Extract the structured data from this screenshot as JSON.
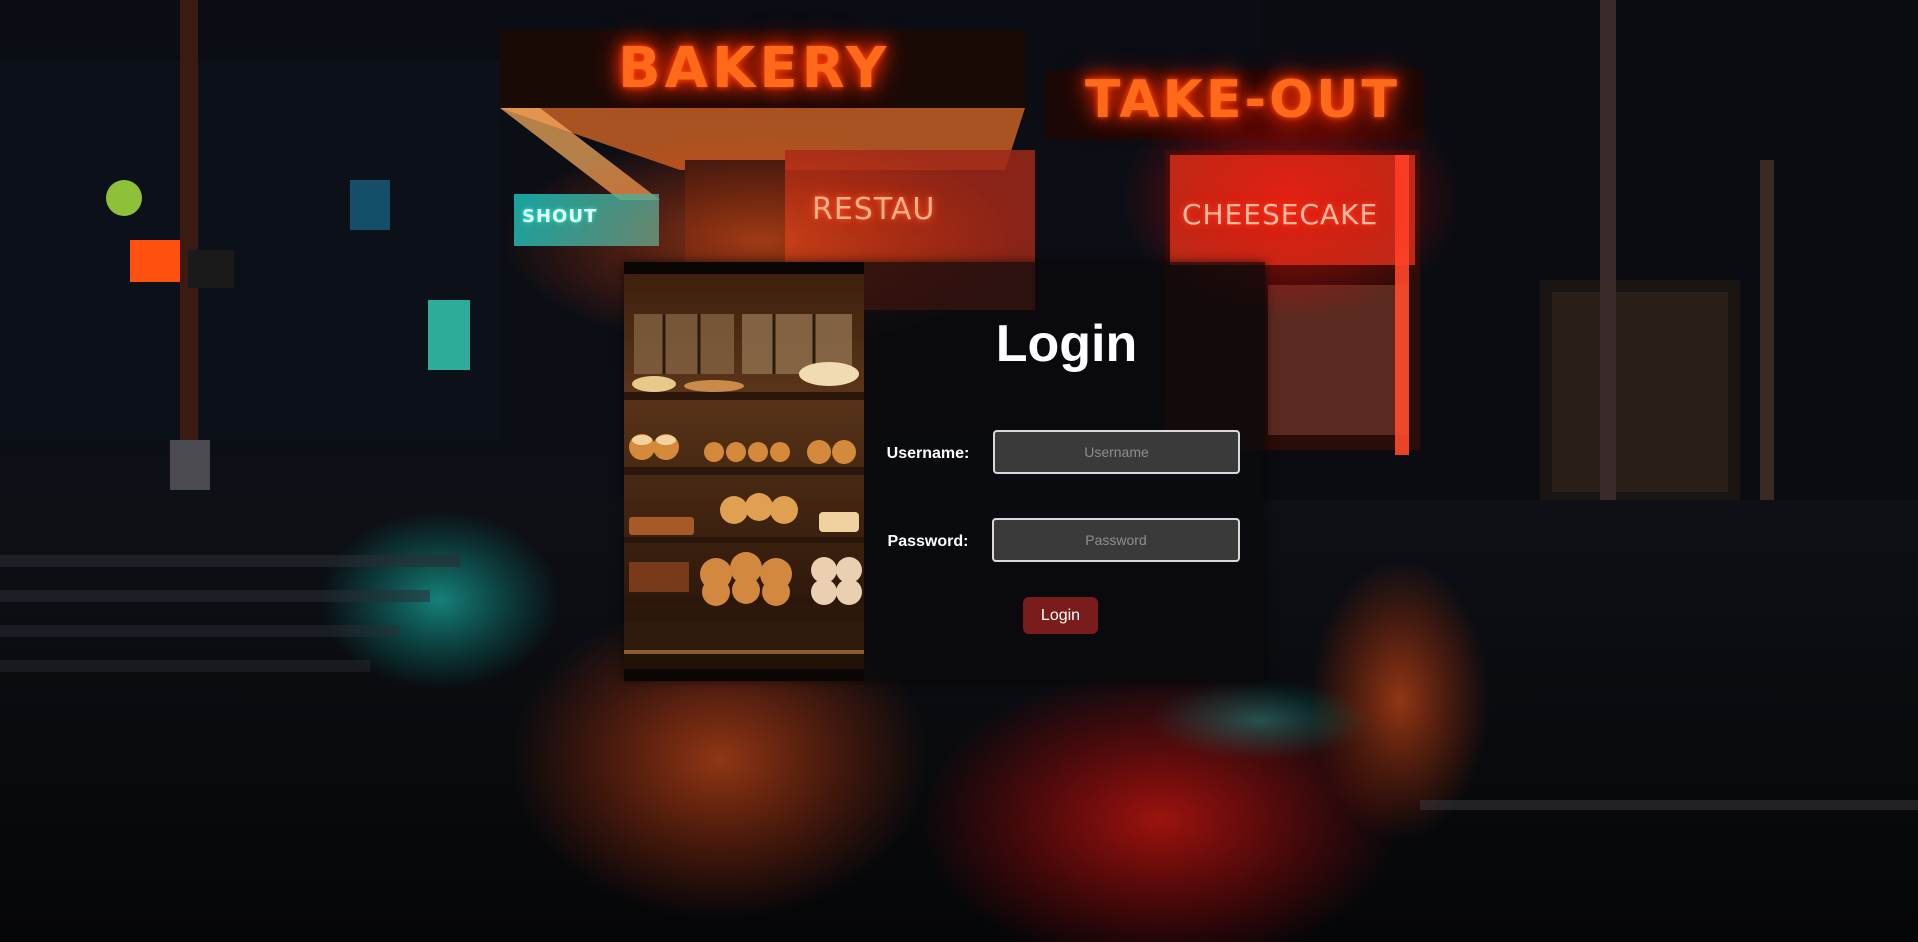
{
  "background": {
    "signs": {
      "bakery": "BAKERY",
      "takeout": "TAKE-OUT",
      "restaurant": "RESTAU",
      "cheesecake": "CHEESECAKE",
      "shout": "SHOUT"
    }
  },
  "login": {
    "title": "Login",
    "username_label": "Username:",
    "username_placeholder": "Username",
    "username_value": "",
    "password_label": "Password:",
    "password_placeholder": "Password",
    "password_value": "",
    "submit_label": "Login"
  },
  "colors": {
    "button": "#7a1c1c",
    "card_background": "#0a0a0c",
    "neon_orange": "#ff6a1a"
  }
}
